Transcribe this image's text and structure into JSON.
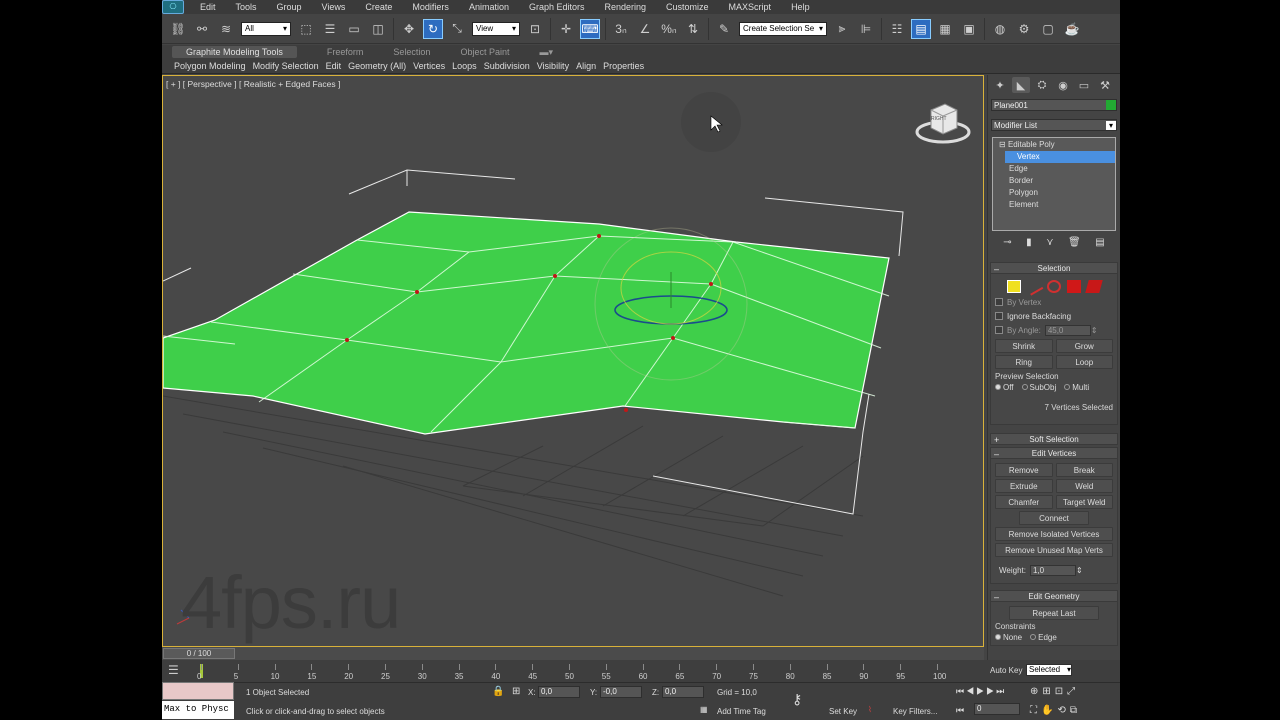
{
  "menu": {
    "items": [
      "Edit",
      "Tools",
      "Group",
      "Views",
      "Create",
      "Modifiers",
      "Animation",
      "Graph Editors",
      "Rendering",
      "Customize",
      "MAXScript",
      "Help"
    ]
  },
  "toolbar": {
    "filter_value": "All",
    "coord_value": "View",
    "selection_set_placeholder": "Create Selection Se"
  },
  "ribbon": {
    "tabs": [
      "Graphite Modeling Tools",
      "Freeform",
      "Selection",
      "Object Paint"
    ],
    "items": [
      "Polygon Modeling",
      "Modify Selection",
      "Edit",
      "Geometry (All)",
      "Vertices",
      "Loops",
      "Subdivision",
      "Visibility",
      "Align",
      "Properties"
    ]
  },
  "viewport": {
    "label": "[ + ] [ Perspective ] [ Realistic + Edged Faces ]",
    "cube_label": "RIGHT",
    "watermark": "4fps.ru"
  },
  "panel": {
    "object_name": "Plane001",
    "modifier_list": "Modifier List",
    "stack": [
      {
        "label": "Editable Poly",
        "level": "root"
      },
      {
        "label": "Vertex",
        "level": "sub",
        "selected": true
      },
      {
        "label": "Edge",
        "level": "sub"
      },
      {
        "label": "Border",
        "level": "sub"
      },
      {
        "label": "Polygon",
        "level": "sub"
      },
      {
        "label": "Element",
        "level": "sub"
      }
    ],
    "selection": {
      "title": "Selection",
      "by_vertex": "By Vertex",
      "ignore_backfacing": "Ignore Backfacing",
      "by_angle": "By Angle:",
      "angle_value": "45,0",
      "shrink": "Shrink",
      "grow": "Grow",
      "ring": "Ring",
      "loop": "Loop",
      "preview_label": "Preview Selection",
      "preview_off": "Off",
      "preview_subobj": "SubObj",
      "preview_multi": "Multi",
      "status": "7 Vertices Selected"
    },
    "soft_selection": "Soft Selection",
    "edit_vertices": {
      "title": "Edit Vertices",
      "remove": "Remove",
      "break": "Break",
      "extrude": "Extrude",
      "weld": "Weld",
      "chamfer": "Chamfer",
      "target_weld": "Target Weld",
      "connect": "Connect",
      "remove_isolated": "Remove Isolated Vertices",
      "remove_unused": "Remove Unused Map Verts",
      "weight_label": "Weight:",
      "weight_value": "1,0"
    },
    "edit_geometry": {
      "title": "Edit Geometry",
      "repeat_last": "Repeat Last",
      "constraints": "Constraints",
      "none": "None",
      "edge": "Edge"
    }
  },
  "timeline": {
    "slider_label": "0 / 100",
    "ticks": [
      "0",
      "5",
      "10",
      "15",
      "20",
      "25",
      "30",
      "35",
      "40",
      "45",
      "50",
      "55",
      "60",
      "65",
      "70",
      "75",
      "80",
      "85",
      "90",
      "95",
      "100"
    ]
  },
  "status": {
    "maxscript_label": "Max to Physc",
    "selected_text": "1 Object Selected",
    "prompt": "Click or click-and-drag to select objects",
    "x_label": "X:",
    "x_value": "0,0",
    "y_label": "Y:",
    "y_value": "-0,0",
    "z_label": "Z:",
    "z_value": "0,0",
    "grid": "Grid = 10,0",
    "add_time_tag": "Add Time Tag",
    "auto_key": "Auto Key",
    "set_key": "Set Key",
    "key_mode": "Selected",
    "key_filters": "Key Filters...",
    "frame": "0"
  },
  "colors": {
    "mesh_fill": "#3fcf4a",
    "accent_blue": "#4a90e0",
    "viewport_border": "#d9b23a",
    "object_color": "#22aa33"
  }
}
